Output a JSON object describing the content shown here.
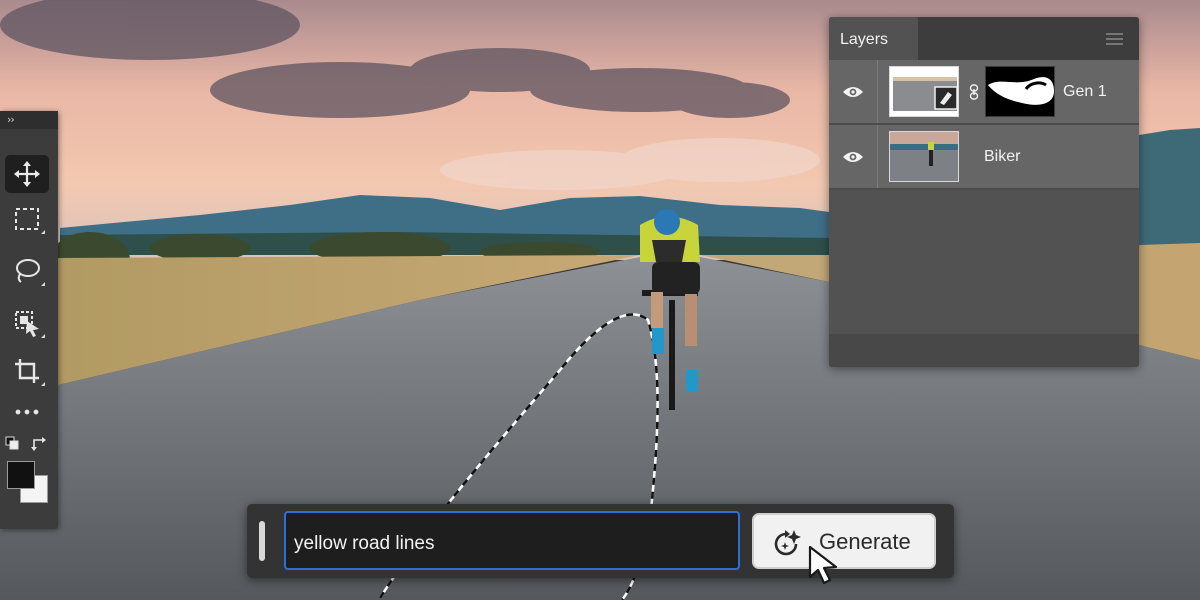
{
  "toolbar": {
    "collapse_label": "››",
    "tools": [
      "move-tool",
      "marquee-tool",
      "lasso-tool",
      "object-select-tool",
      "crop-tool",
      "more-tools"
    ],
    "active_tool": "move-tool",
    "foreground_color": "#111111",
    "background_color": "#f4f4f4"
  },
  "layers_panel": {
    "title": "Layers",
    "layers": [
      {
        "name": "Gen 1",
        "visible": true,
        "has_mask": true
      },
      {
        "name": "Biker",
        "visible": true,
        "has_mask": false
      }
    ]
  },
  "generative_fill": {
    "prompt_value": "yellow road lines",
    "button_label": "Generate",
    "accent_color": "#2f6fd5"
  }
}
